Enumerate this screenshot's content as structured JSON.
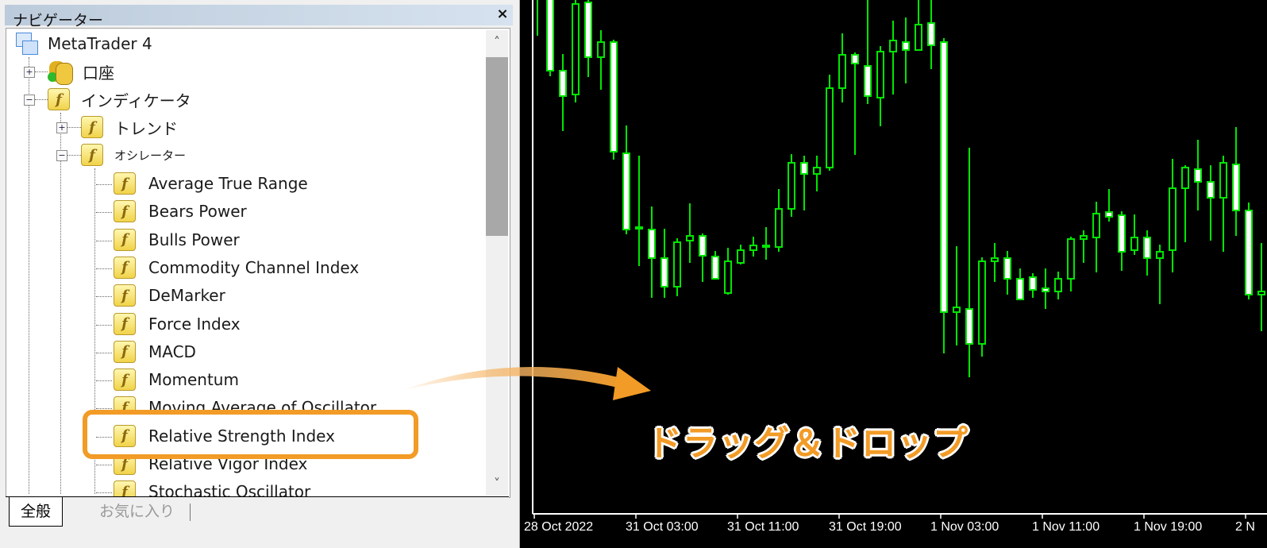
{
  "navigator": {
    "title": "ナビゲーター",
    "close_icon": "×",
    "root": "MetaTrader 4",
    "items": [
      {
        "label": "口座",
        "icon": "accounts-icon",
        "expander": "+"
      },
      {
        "label": "インディケータ",
        "icon": "indicator-folder-icon",
        "expander": "−"
      },
      {
        "label": "トレンド",
        "icon": "indicator-folder-icon",
        "expander": "+"
      },
      {
        "label": "オシレーター",
        "icon": "indicator-folder-icon",
        "expander": "−"
      }
    ],
    "oscillators": [
      "Average True Range",
      "Bears Power",
      "Bulls Power",
      "Commodity Channel Index",
      "DeMarker",
      "Force Index",
      "MACD",
      "Momentum",
      "Moving Average of Oscillator",
      "Relative Strength Index",
      "Relative Vigor Index",
      "Stochastic Oscillator"
    ],
    "highlighted": "Relative Strength Index",
    "scroll_up": "˄",
    "scroll_down": "˅",
    "tabs": [
      {
        "label": "全般",
        "active": true
      },
      {
        "label": "お気に入り",
        "active": false
      }
    ]
  },
  "chart": {
    "time_labels": [
      "28 Oct 2022",
      "31 Oct 03:00",
      "31 Oct 11:00",
      "31 Oct 19:00",
      "1 Nov 03:00",
      "1 Nov 11:00",
      "1 Nov 19:00",
      "2 N"
    ],
    "candle_color": "#00e600",
    "background": "#000000"
  },
  "annotation": {
    "text": "ドラッグ＆ドロップ",
    "color": "#f29b26"
  }
}
